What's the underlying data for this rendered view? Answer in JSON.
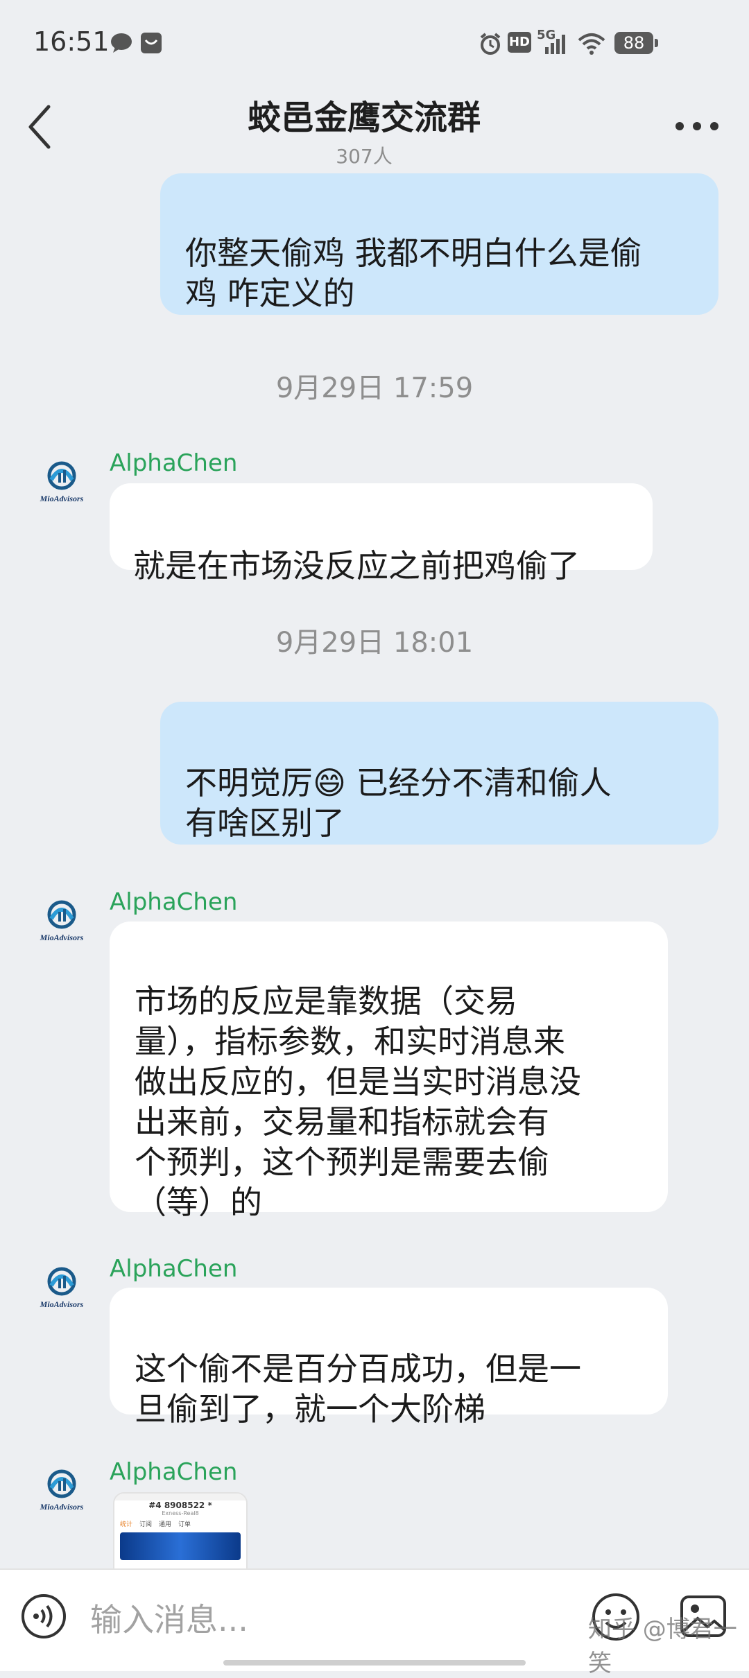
{
  "status_bar": {
    "time": "16:51",
    "network": "5G",
    "hd": "HD",
    "battery": "88"
  },
  "header": {
    "title": "蛟邑金鹰交流群",
    "member_count": "307人"
  },
  "messages": [
    {
      "type": "outgoing",
      "text": "你整天偷鸡 我都不明白什么是偷\n鸡 咋定义的"
    },
    {
      "type": "timestamp",
      "text": "9月29日 17:59"
    },
    {
      "type": "incoming",
      "sender": "AlphaChen",
      "text": "就是在市场没反应之前把鸡偷了"
    },
    {
      "type": "timestamp",
      "text": "9月29日 18:01"
    },
    {
      "type": "outgoing",
      "text_before_emoji": "不明觉厉",
      "emoji": "😄",
      "text_after_emoji": " 已经分不清和偷人\n有啥区别了"
    },
    {
      "type": "incoming",
      "sender": "AlphaChen",
      "text": "市场的反应是靠数据（交易\n量），指标参数，和实时消息来\n做出反应的，但是当实时消息没\n出来前，交易量和指标就会有\n个预判，这个预判是需要去偷\n（等）的"
    },
    {
      "type": "incoming",
      "sender": "AlphaChen",
      "text": "这个偷不是百分百成功，但是一\n旦偷到了，就一个大阶梯"
    },
    {
      "type": "incoming_image",
      "sender": "AlphaChen",
      "image_text": "#4  8908522 *",
      "image_sub": "Exness-Real8",
      "image_tabs": [
        "统计",
        "订阅",
        "通用",
        "订单"
      ]
    }
  ],
  "avatar_label": "MioAdvisors",
  "input": {
    "placeholder": "输入消息..."
  },
  "watermark": "知乎 @博君一笑",
  "colors": {
    "sender": "#2aa35a",
    "outgoing_bubble": "#cde7fb",
    "incoming_bubble": "#ffffff",
    "background": "#edeff2"
  }
}
